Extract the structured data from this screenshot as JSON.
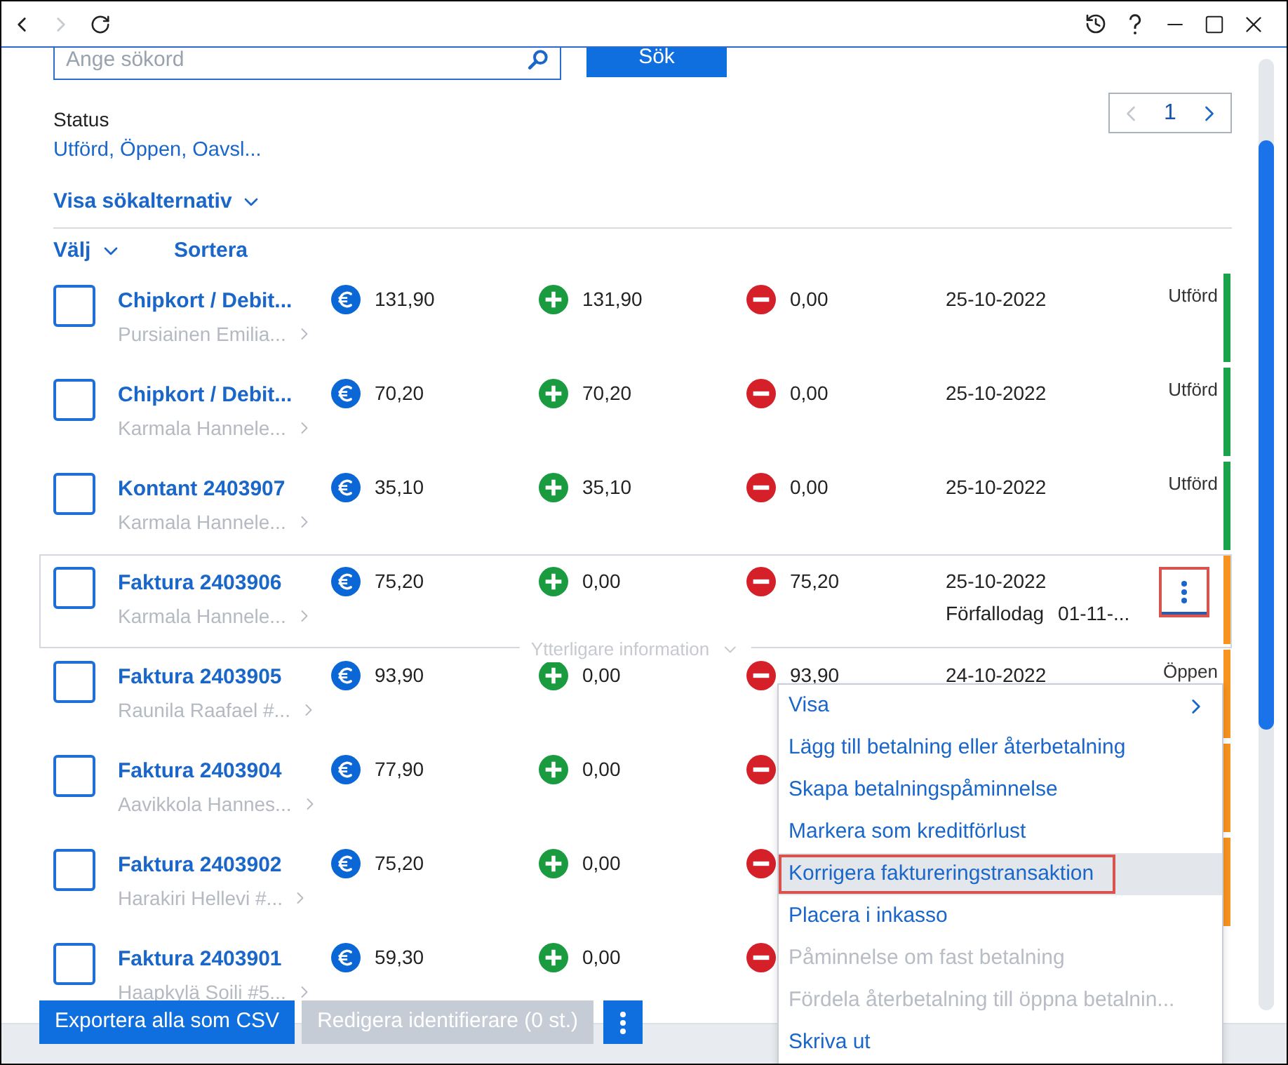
{
  "window": {
    "back_enabled": true,
    "forward_enabled": false
  },
  "search": {
    "placeholder": "Ange sökord",
    "button": "Sök"
  },
  "status_filter": {
    "label": "Status",
    "value": "Utförd, Öppen, Oavsl..."
  },
  "pagination": {
    "page": "1",
    "prev_enabled": false,
    "next_enabled": true
  },
  "search_options": {
    "label": "Visa sökalternativ",
    "expanded": false
  },
  "list_header": {
    "select": "Välj",
    "sort": "Sortera"
  },
  "rows": [
    {
      "title": "Chipkort / Debit...",
      "customer": "Pursiainen Emilia...",
      "checked": false,
      "focused": false,
      "amount": "131,90",
      "paid": "131,90",
      "remaining": "0,00",
      "date": "25-10-2022",
      "status": "Utförd",
      "color": "#1ba34b"
    },
    {
      "title": "Chipkort / Debit...",
      "customer": "Karmala Hannele...",
      "checked": false,
      "focused": false,
      "amount": "70,20",
      "paid": "70,20",
      "remaining": "0,00",
      "date": "25-10-2022",
      "status": "Utförd",
      "color": "#1ba34b"
    },
    {
      "title": "Kontant 2403907",
      "customer": "Karmala Hannele...",
      "checked": false,
      "focused": false,
      "amount": "35,10",
      "paid": "35,10",
      "remaining": "0,00",
      "date": "25-10-2022",
      "status": "Utförd",
      "color": "#1ba34b"
    },
    {
      "title": "Faktura 2403906",
      "customer": "Karmala Hannele...",
      "checked": false,
      "focused": true,
      "amount": "75,20",
      "paid": "0,00",
      "remaining": "75,20",
      "date": "25-10-2022",
      "due": {
        "label": "Förfallodag",
        "value": "01-11-..."
      },
      "menu_button": {
        "marked": true
      },
      "more_info": {
        "label": "Ytterligare information",
        "expanded": false
      },
      "color": "#f7931e"
    },
    {
      "title": "Faktura 2403905",
      "customer": "Raunila Raafael #...",
      "checked": false,
      "focused": false,
      "amount": "93,90",
      "paid": "0,00",
      "remaining": "93,90",
      "date": "24-10-2022",
      "status": "Öppen",
      "color": "#f7931e"
    },
    {
      "title": "Faktura 2403904",
      "customer": "Aavikkola Hannes...",
      "checked": false,
      "focused": false,
      "amount": "77,90",
      "paid": "0,00",
      "color": "#f7931e"
    },
    {
      "title": "Faktura 2403902",
      "customer": "Harakiri Hellevi #...",
      "checked": false,
      "focused": false,
      "amount": "75,20",
      "paid": "0,00",
      "color": "#f7931e"
    },
    {
      "title": "Faktura 2403901",
      "customer": "Haapkylä Soili #5...",
      "checked": false,
      "focused": false,
      "amount": "59,30",
      "paid": "0,00"
    }
  ],
  "context_menu": {
    "items": [
      {
        "label": "Visa",
        "kind": "submenu",
        "disabled": false,
        "selected": false,
        "marked": false
      },
      {
        "label": "Lägg till betalning eller återbetalning",
        "kind": "action",
        "disabled": false,
        "selected": false,
        "marked": false
      },
      {
        "label": "Skapa betalningspåminnelse",
        "kind": "action",
        "disabled": false,
        "selected": false,
        "marked": false
      },
      {
        "label": "Markera som kreditförlust",
        "kind": "action",
        "disabled": false,
        "selected": false,
        "marked": false
      },
      {
        "label": "Korrigera faktureringstransaktion",
        "kind": "action",
        "disabled": false,
        "selected": true,
        "marked": true
      },
      {
        "label": "Placera i inkasso",
        "kind": "action",
        "disabled": false,
        "selected": false,
        "marked": false
      },
      {
        "label": "Påminnelse om fast betalning",
        "kind": "action",
        "disabled": true,
        "selected": false,
        "marked": false
      },
      {
        "label": "Fördela återbetalning till öppna betalnin...",
        "kind": "action",
        "disabled": true,
        "selected": false,
        "marked": false
      },
      {
        "label": "Skriva ut",
        "kind": "action",
        "disabled": false,
        "selected": false,
        "marked": false
      }
    ]
  },
  "actions": [
    {
      "kind": "button",
      "label": "Exportera alla som CSV",
      "disabled": false
    },
    {
      "kind": "button",
      "label": "Redigera identifierare (0 st.)",
      "disabled": true
    },
    {
      "kind": "more",
      "disabled": false
    }
  ]
}
